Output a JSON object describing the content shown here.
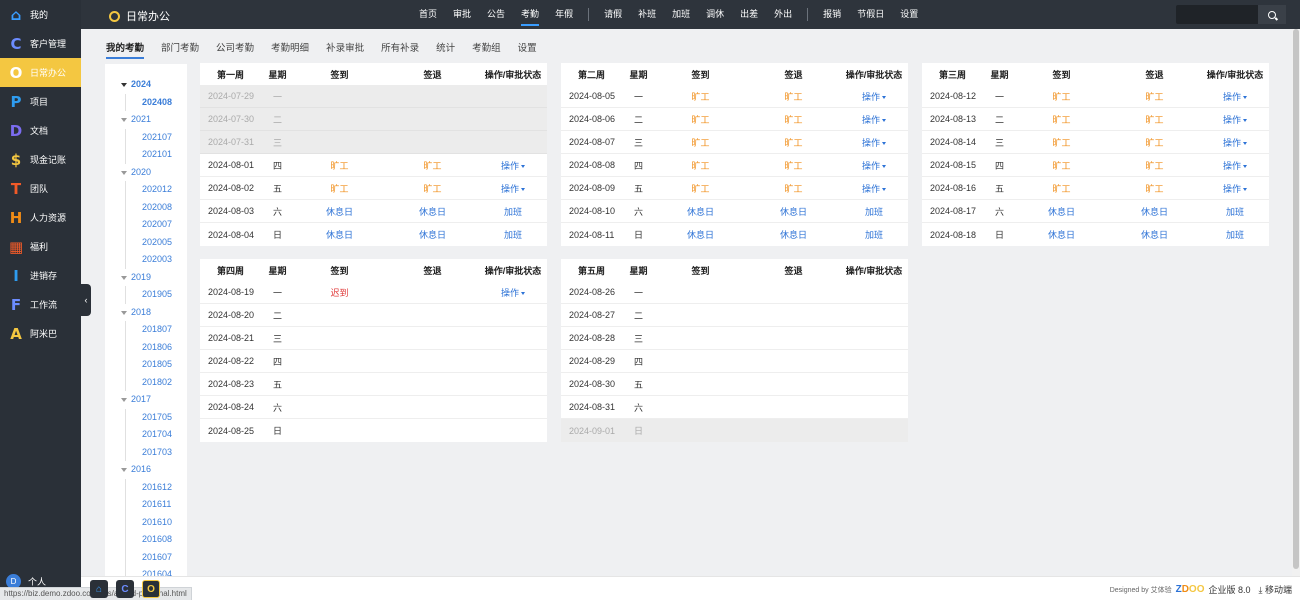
{
  "sidebar": {
    "items": [
      {
        "icon": "⌂",
        "icon_name": "home-icon",
        "label": "我的",
        "color": "#3a9dff",
        "active": false
      },
      {
        "icon": "C",
        "icon_name": "crm-icon",
        "label": "客户管理",
        "color": "#6c8cff",
        "active": false
      },
      {
        "icon": "O",
        "icon_name": "office-icon",
        "label": "日常办公",
        "color": "#ffffff",
        "active": true
      },
      {
        "icon": "P",
        "icon_name": "project-icon",
        "label": "项目",
        "color": "#2e9cf0",
        "active": false
      },
      {
        "icon": "D",
        "icon_name": "document-icon",
        "label": "文档",
        "color": "#7b6cf0",
        "active": false
      },
      {
        "icon": "$",
        "icon_name": "cash-icon",
        "label": "现金记账",
        "color": "#f4c741",
        "active": false
      },
      {
        "icon": "T",
        "icon_name": "team-icon",
        "label": "团队",
        "color": "#f05a28",
        "active": false
      },
      {
        "icon": "H",
        "icon_name": "hr-icon",
        "label": "人力资源",
        "color": "#f08c16",
        "active": false
      },
      {
        "icon": "▦",
        "icon_name": "gift-icon",
        "label": "福利",
        "color": "#f05a28",
        "active": false
      },
      {
        "icon": "I",
        "icon_name": "inventory-icon",
        "label": "进销存",
        "color": "#2e9cf0",
        "active": false
      },
      {
        "icon": "F",
        "icon_name": "workflow-icon",
        "label": "工作流",
        "color": "#6c8cff",
        "active": false
      },
      {
        "icon": "A",
        "icon_name": "amoeba-icon",
        "label": "阿米巴",
        "color": "#f4c741",
        "active": false
      }
    ],
    "user_initial": "D",
    "user_label": "个人"
  },
  "header": {
    "app_title": "日常办公",
    "nav": [
      "首页",
      "审批",
      "公告",
      "考勤",
      "年假",
      "|",
      "请假",
      "补班",
      "加班",
      "调休",
      "出差",
      "外出",
      "|",
      "报销",
      "节假日",
      "设置"
    ],
    "active_nav": "考勤"
  },
  "subtabs": {
    "items": [
      "我的考勤",
      "部门考勤",
      "公司考勤",
      "考勤明细",
      "补录审批",
      "所有补录",
      "统计",
      "考勤组",
      "设置"
    ],
    "active": "我的考勤"
  },
  "tree": [
    {
      "year": "2024",
      "expanded": true,
      "months": [
        "202408"
      ],
      "active_month": "202408"
    },
    {
      "year": "2021",
      "months": [
        "202107",
        "202101"
      ]
    },
    {
      "year": "2020",
      "months": [
        "202012",
        "202008",
        "202007",
        "202005",
        "202003"
      ]
    },
    {
      "year": "2019",
      "months": [
        "201905"
      ]
    },
    {
      "year": "2018",
      "months": [
        "201807",
        "201806",
        "201805",
        "201802"
      ]
    },
    {
      "year": "2017",
      "months": [
        "201705",
        "201704",
        "201703"
      ]
    },
    {
      "year": "2016",
      "months": [
        "201612",
        "201611",
        "201610",
        "201608",
        "201607",
        "201604"
      ]
    }
  ],
  "table_headers": {
    "weekday": "星期",
    "sign_in": "签到",
    "sign_out": "签退",
    "op": "操作/审批状态"
  },
  "op_label": "操作",
  "weeks": [
    {
      "title": "第一周",
      "rows": [
        {
          "date": "2024-07-29",
          "wd": "一",
          "in": "",
          "out": "",
          "op": "",
          "gray": true
        },
        {
          "date": "2024-07-30",
          "wd": "二",
          "in": "",
          "out": "",
          "op": "",
          "gray": true
        },
        {
          "date": "2024-07-31",
          "wd": "三",
          "in": "",
          "out": "",
          "op": "",
          "gray": true
        },
        {
          "date": "2024-08-01",
          "wd": "四",
          "in": "旷工",
          "out": "旷工",
          "op": "menu"
        },
        {
          "date": "2024-08-02",
          "wd": "五",
          "in": "旷工",
          "out": "旷工",
          "op": "menu"
        },
        {
          "date": "2024-08-03",
          "wd": "六",
          "in": "休息日",
          "out": "休息日",
          "op": "加班"
        },
        {
          "date": "2024-08-04",
          "wd": "日",
          "in": "休息日",
          "out": "休息日",
          "op": "加班"
        }
      ]
    },
    {
      "title": "第二周",
      "rows": [
        {
          "date": "2024-08-05",
          "wd": "一",
          "in": "旷工",
          "out": "旷工",
          "op": "menu"
        },
        {
          "date": "2024-08-06",
          "wd": "二",
          "in": "旷工",
          "out": "旷工",
          "op": "menu"
        },
        {
          "date": "2024-08-07",
          "wd": "三",
          "in": "旷工",
          "out": "旷工",
          "op": "menu"
        },
        {
          "date": "2024-08-08",
          "wd": "四",
          "in": "旷工",
          "out": "旷工",
          "op": "menu"
        },
        {
          "date": "2024-08-09",
          "wd": "五",
          "in": "旷工",
          "out": "旷工",
          "op": "menu"
        },
        {
          "date": "2024-08-10",
          "wd": "六",
          "in": "休息日",
          "out": "休息日",
          "op": "加班"
        },
        {
          "date": "2024-08-11",
          "wd": "日",
          "in": "休息日",
          "out": "休息日",
          "op": "加班"
        }
      ]
    },
    {
      "title": "第三周",
      "rows": [
        {
          "date": "2024-08-12",
          "wd": "一",
          "in": "旷工",
          "out": "旷工",
          "op": "menu"
        },
        {
          "date": "2024-08-13",
          "wd": "二",
          "in": "旷工",
          "out": "旷工",
          "op": "menu"
        },
        {
          "date": "2024-08-14",
          "wd": "三",
          "in": "旷工",
          "out": "旷工",
          "op": "menu"
        },
        {
          "date": "2024-08-15",
          "wd": "四",
          "in": "旷工",
          "out": "旷工",
          "op": "menu"
        },
        {
          "date": "2024-08-16",
          "wd": "五",
          "in": "旷工",
          "out": "旷工",
          "op": "menu"
        },
        {
          "date": "2024-08-17",
          "wd": "六",
          "in": "休息日",
          "out": "休息日",
          "op": "加班"
        },
        {
          "date": "2024-08-18",
          "wd": "日",
          "in": "休息日",
          "out": "休息日",
          "op": "加班"
        }
      ]
    },
    {
      "title": "第四周",
      "rows": [
        {
          "date": "2024-08-19",
          "wd": "一",
          "in": "迟到",
          "out": "",
          "op": "menu"
        },
        {
          "date": "2024-08-20",
          "wd": "二",
          "in": "",
          "out": "",
          "op": ""
        },
        {
          "date": "2024-08-21",
          "wd": "三",
          "in": "",
          "out": "",
          "op": ""
        },
        {
          "date": "2024-08-22",
          "wd": "四",
          "in": "",
          "out": "",
          "op": ""
        },
        {
          "date": "2024-08-23",
          "wd": "五",
          "in": "",
          "out": "",
          "op": ""
        },
        {
          "date": "2024-08-24",
          "wd": "六",
          "in": "",
          "out": "",
          "op": ""
        },
        {
          "date": "2024-08-25",
          "wd": "日",
          "in": "",
          "out": "",
          "op": ""
        }
      ]
    },
    {
      "title": "第五周",
      "rows": [
        {
          "date": "2024-08-26",
          "wd": "一",
          "in": "",
          "out": "",
          "op": ""
        },
        {
          "date": "2024-08-27",
          "wd": "二",
          "in": "",
          "out": "",
          "op": ""
        },
        {
          "date": "2024-08-28",
          "wd": "三",
          "in": "",
          "out": "",
          "op": ""
        },
        {
          "date": "2024-08-29",
          "wd": "四",
          "in": "",
          "out": "",
          "op": ""
        },
        {
          "date": "2024-08-30",
          "wd": "五",
          "in": "",
          "out": "",
          "op": ""
        },
        {
          "date": "2024-08-31",
          "wd": "六",
          "in": "",
          "out": "",
          "op": ""
        },
        {
          "date": "2024-09-01",
          "wd": "日",
          "in": "",
          "out": "",
          "op": "",
          "gray": true
        }
      ]
    }
  ],
  "status_colors": {
    "旷工": "#f08c16",
    "休息日": "#2c72d6",
    "迟到": "#e03a3a",
    "加班": "#2c72d6"
  },
  "footer": {
    "designed_by": "Designed by 艾体验",
    "brand": [
      "Z",
      "D",
      "O",
      "O"
    ],
    "edition": "企业版 8.0",
    "mobile": "移动端",
    "url_hint": "https://biz.demo.zdoo.com/sys/attend-personal.html"
  },
  "taskbar": [
    {
      "icon": "⌂",
      "name": "taskbar-home-icon"
    },
    {
      "icon": "C",
      "name": "taskbar-crm-icon"
    },
    {
      "icon": "O",
      "name": "taskbar-office-icon",
      "active": true
    }
  ]
}
